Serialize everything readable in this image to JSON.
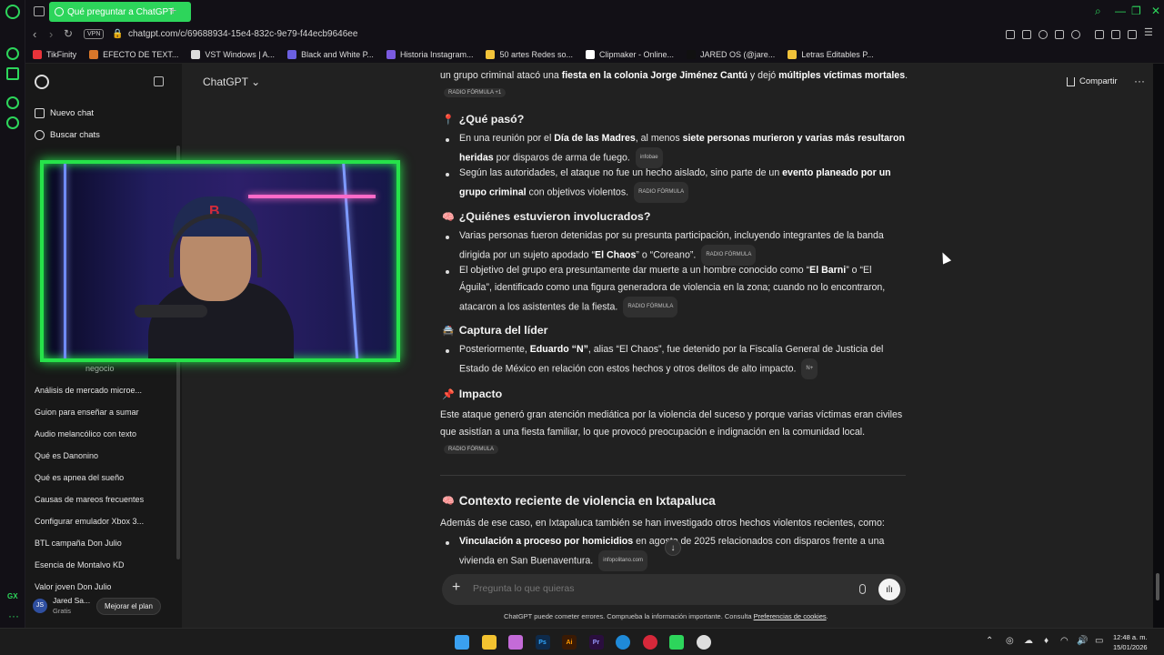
{
  "browser": {
    "tab_title": "Qué preguntar a ChatGPT",
    "url": "chatgpt.com/c/69688934-15e4-832c-9e79-f44ecb9646ee",
    "vpn_label": "VPN",
    "gx_label": "GX",
    "accent": "#2dd55b",
    "bookmarks": [
      {
        "label": "TikFinity",
        "color": "#e8333a"
      },
      {
        "label": "EFECTO DE TEXT...",
        "color": "#d9772a"
      },
      {
        "label": "VST Windows | A...",
        "color": "#dddddd"
      },
      {
        "label": "Black and White P...",
        "color": "#6b5fe0"
      },
      {
        "label": "Historia Instagram...",
        "color": "#7a5ae0"
      },
      {
        "label": "50 artes Redes so...",
        "color": "#f3c43a"
      },
      {
        "label": "Clipmaker - Online...",
        "color": "#ffffff"
      },
      {
        "label": "JARED OS (@jare...",
        "color": "#111111"
      },
      {
        "label": "Letras Editables P...",
        "color": "#f0c23a"
      }
    ]
  },
  "sidebar": {
    "new_chat": "Nuevo chat",
    "search_chats": "Buscar chats",
    "partial_item": "negocio",
    "chats": [
      "Análisis de mercado microe...",
      "Guion para enseñar a sumar",
      "Audio melancólico con texto",
      "Qué es Danonino",
      "Qué es apnea del sueño",
      "Causas de mareos frecuentes",
      "Configurar emulador Xbox 3...",
      "BTL campaña Don Julio",
      "Esencia de Montalvo KD",
      "Valor joven Don Julio"
    ],
    "user": {
      "initials": "JS",
      "name": "Jared Sa...",
      "plan": "Gratis"
    },
    "upgrade": "Mejorar el plan"
  },
  "header": {
    "model": "ChatGPT",
    "share": "Compartir",
    "more": "···"
  },
  "chat": {
    "intro": {
      "pre": "un grupo criminal atacó una ",
      "b1": "fiesta en la colonia Jorge Jiménez Cantú",
      "mid": " y dejó ",
      "b2": "múltiples víctimas mortales",
      "post": ".",
      "source": "RADIO FÓRMULA +1"
    },
    "s1": {
      "emoji": "📍",
      "title": "¿Qué pasó?",
      "b1": {
        "pre": "En una reunión por el ",
        "bold1": "Día de las Madres",
        "mid": ", al menos ",
        "bold2": "siete personas murieron y varias más resultaron heridas",
        "post": " por disparos de arma de fuego.",
        "source": "infobae"
      },
      "b2": {
        "pre": "Según las autoridades, el ataque no fue un hecho aislado, sino parte de un ",
        "bold1": "evento planeado por un grupo criminal",
        "post": " con objetivos violentos.",
        "source": "RADIO FÓRMULA"
      }
    },
    "s2": {
      "emoji": "🧠",
      "title": "¿Quiénes estuvieron involucrados?",
      "b1": {
        "pre": "Varias personas fueron detenidas por su presunta participación, incluyendo integrantes de la banda dirigida por un sujeto apodado “",
        "bold1": "El Chaos",
        "post": "” o “Coreano”.",
        "source": "RADIO FÓRMULA"
      },
      "b2": {
        "pre": "El objetivo del grupo era presuntamente dar muerte a un hombre conocido como “",
        "bold1": "El Barni",
        "post": "” o “El Águila”, identificado como una figura generadora de violencia en la zona; cuando no lo encontraron, atacaron a los asistentes de la fiesta.",
        "source": "RADIO FÓRMULA"
      }
    },
    "s3": {
      "emoji": "🚔",
      "title": "Captura del líder",
      "b1": {
        "pre": "Posteriormente, ",
        "bold1": "Eduardo “N”",
        "post": ", alias “El Chaos”, fue detenido por la Fiscalía General de Justicia del Estado de México en relación con estos hechos y otros delitos de alto impacto.",
        "source": "N+"
      }
    },
    "s4": {
      "emoji": "📌",
      "title": "Impacto",
      "text": "Este ataque generó gran atención mediática por la violencia del suceso y porque varias víctimas eran civiles que asistían a una fiesta familiar, lo que provocó preocupación e indignación en la comunidad local.",
      "source": "RADIO FÓRMULA"
    },
    "s5": {
      "emoji": "🧠",
      "title": "Contexto reciente de violencia en Ixtapaluca",
      "text": "Además de ese caso, en Ixtapaluca también se han investigado otros hechos violentos recientes, como:",
      "b1": {
        "bold1": "Vinculación a proceso por homicidios",
        "pre": " en agosto de 2025 relacionados con disparos frente a una vivienda en San Buenaventura.",
        "source": "infopolitano.com"
      }
    }
  },
  "composer": {
    "placeholder": "Pregunta lo que quieras",
    "disclaimer_pre": "ChatGPT puede cometer errores. Comprueba la información importante. Consulta ",
    "disclaimer_link": "Preferencias de cookies",
    "disclaimer_post": "."
  },
  "taskbar": {
    "apps": [
      {
        "name": "windows-start-icon",
        "color": "#3aa0f0",
        "label": ""
      },
      {
        "name": "file-explorer-icon",
        "color": "#f2c230",
        "label": ""
      },
      {
        "name": "copilot-icon",
        "color": "#c46bd8",
        "label": ""
      },
      {
        "name": "photoshop-icon",
        "color": "#0e2a4a",
        "label": "Ps"
      },
      {
        "name": "illustrator-icon",
        "color": "#3a1a04",
        "label": "Ai"
      },
      {
        "name": "premiere-icon",
        "color": "#2a0e3e",
        "label": "Pr"
      },
      {
        "name": "edge-icon",
        "color": "#1f8ad8",
        "label": ""
      },
      {
        "name": "opera-icon",
        "color": "#d6283a",
        "label": ""
      },
      {
        "name": "chatgpt-app-icon",
        "color": "#2dd55b",
        "label": ""
      },
      {
        "name": "obs-icon",
        "color": "#dddddd",
        "label": ""
      }
    ],
    "time": "12:48 a. m.",
    "date": "15/01/2026"
  }
}
